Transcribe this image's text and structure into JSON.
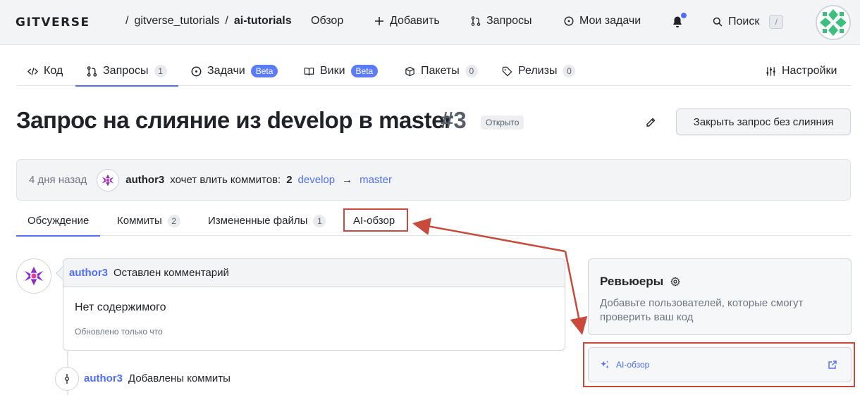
{
  "header": {
    "logo": "GITVERSE",
    "breadcrumb": {
      "owner": "gitverse_tutorials",
      "sep1": "/",
      "sep2": "/",
      "repo": "ai-tutorials"
    },
    "nav": {
      "overview": "Обзор",
      "add": "Добавить",
      "requests": "Запросы",
      "my_tasks": "Мои задачи",
      "search": "Поиск",
      "search_shortcut": "/"
    },
    "notification_dot_color": "#4f6ef7"
  },
  "repo_tabs": {
    "code": "Код",
    "requests": "Запросы",
    "requests_count": "1",
    "tasks": "Задачи",
    "tasks_badge": "Beta",
    "wiki": "Вики",
    "wiki_badge": "Beta",
    "packages": "Пакеты",
    "packages_count": "0",
    "releases": "Релизы",
    "releases_count": "0",
    "settings": "Настройки"
  },
  "pr": {
    "title": "Запрос на слияние из develop в master",
    "number": "#3",
    "status": "Открыто",
    "close_button": "Закрыть запрос без слияния",
    "info": {
      "time": "4 дня назад",
      "author": "author3",
      "text": "хочет влить коммитов:",
      "commit_count": "2",
      "source_branch": "develop",
      "arrow": "→",
      "target_branch": "master"
    }
  },
  "pr_tabs": {
    "discussion": "Обсуждение",
    "commits": "Коммиты",
    "commits_count": "2",
    "changed_files": "Измененные файлы",
    "changed_files_count": "1",
    "ai_review": "AI-обзор"
  },
  "timeline": {
    "comment": {
      "author": "author3",
      "action": "Оставлен комментарий",
      "body": "Нет содержимого",
      "updated": "Обновлено только что"
    },
    "commit_event": {
      "author": "author3",
      "action": "Добавлены коммиты"
    }
  },
  "sidebar": {
    "reviewers_title": "Ревьюеры",
    "reviewers_desc": "Добавьте пользователей, которые смогут проверить ваш код",
    "ai_review_label": "AI-обзор"
  },
  "colors": {
    "accent": "#4f6ef7",
    "annotation": "#c94a3b"
  }
}
